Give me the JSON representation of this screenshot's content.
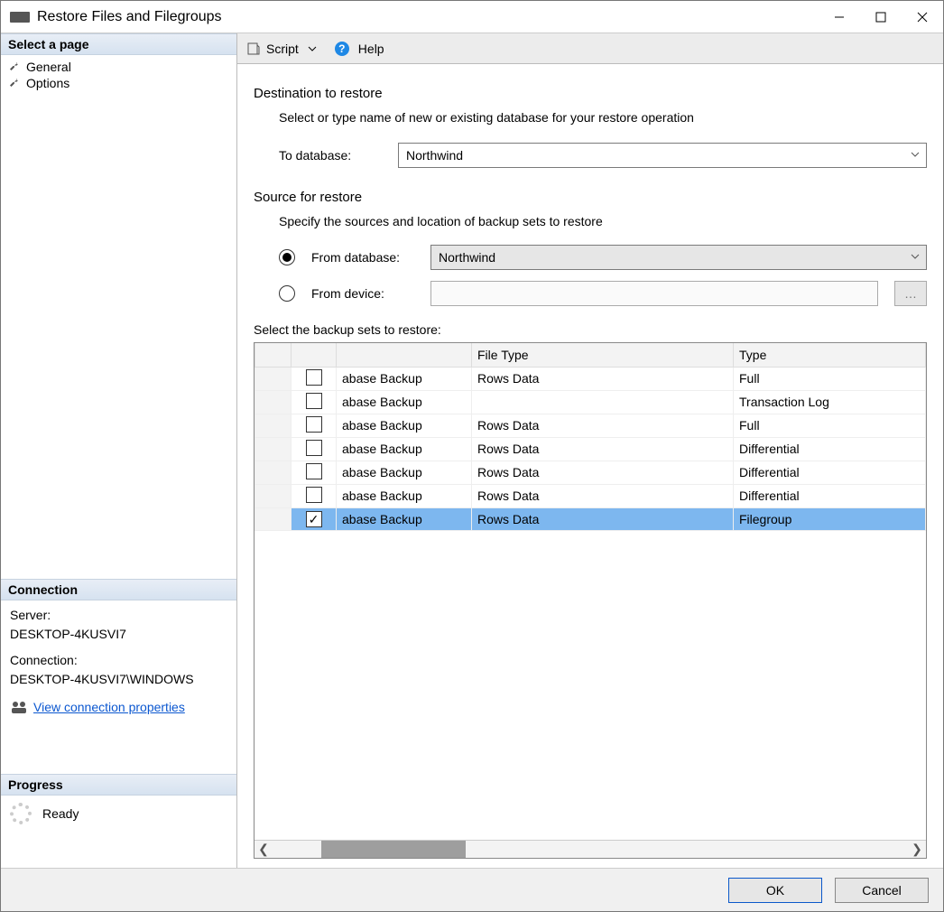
{
  "window": {
    "title": "Restore Files and Filegroups"
  },
  "sidebar": {
    "select_page_header": "Select a page",
    "pages": [
      {
        "label": "General"
      },
      {
        "label": "Options"
      }
    ],
    "connection_header": "Connection",
    "server_label": "Server:",
    "server_value": "DESKTOP-4KUSVI7",
    "connection_label": "Connection:",
    "connection_value": "DESKTOP-4KUSVI7\\WINDOWS",
    "view_conn_props": "View connection properties",
    "progress_header": "Progress",
    "progress_status": "Ready"
  },
  "toolbar": {
    "script_label": "Script",
    "help_label": "Help"
  },
  "content": {
    "dest_title": "Destination to restore",
    "dest_hint": "Select or type name of new or existing database for your restore operation",
    "to_db_label": "To database:",
    "to_db_value": "Northwind",
    "src_title": "Source for restore",
    "src_hint": "Specify the sources and location of backup sets to restore",
    "from_db_label": "From database:",
    "from_db_value": "Northwind",
    "from_device_label": "From device:",
    "select_sets_label": "Select the backup sets to restore:",
    "columns": {
      "name_trunc": "",
      "file_type": "File Type",
      "type": "Type"
    },
    "rows": [
      {
        "checked": false,
        "name": "abase Backup",
        "file_type": "Rows Data",
        "type": "Full"
      },
      {
        "checked": false,
        "name": "abase Backup",
        "file_type": "",
        "type": "Transaction Log"
      },
      {
        "checked": false,
        "name": "abase Backup",
        "file_type": "Rows Data",
        "type": "Full"
      },
      {
        "checked": false,
        "name": "abase Backup",
        "file_type": "Rows Data",
        "type": "Differential"
      },
      {
        "checked": false,
        "name": "abase Backup",
        "file_type": "Rows Data",
        "type": "Differential"
      },
      {
        "checked": false,
        "name": "abase Backup",
        "file_type": "Rows Data",
        "type": "Differential"
      },
      {
        "checked": true,
        "name": "abase Backup",
        "file_type": "Rows Data",
        "type": "Filegroup",
        "selected": true
      }
    ]
  },
  "footer": {
    "ok": "OK",
    "cancel": "Cancel"
  }
}
